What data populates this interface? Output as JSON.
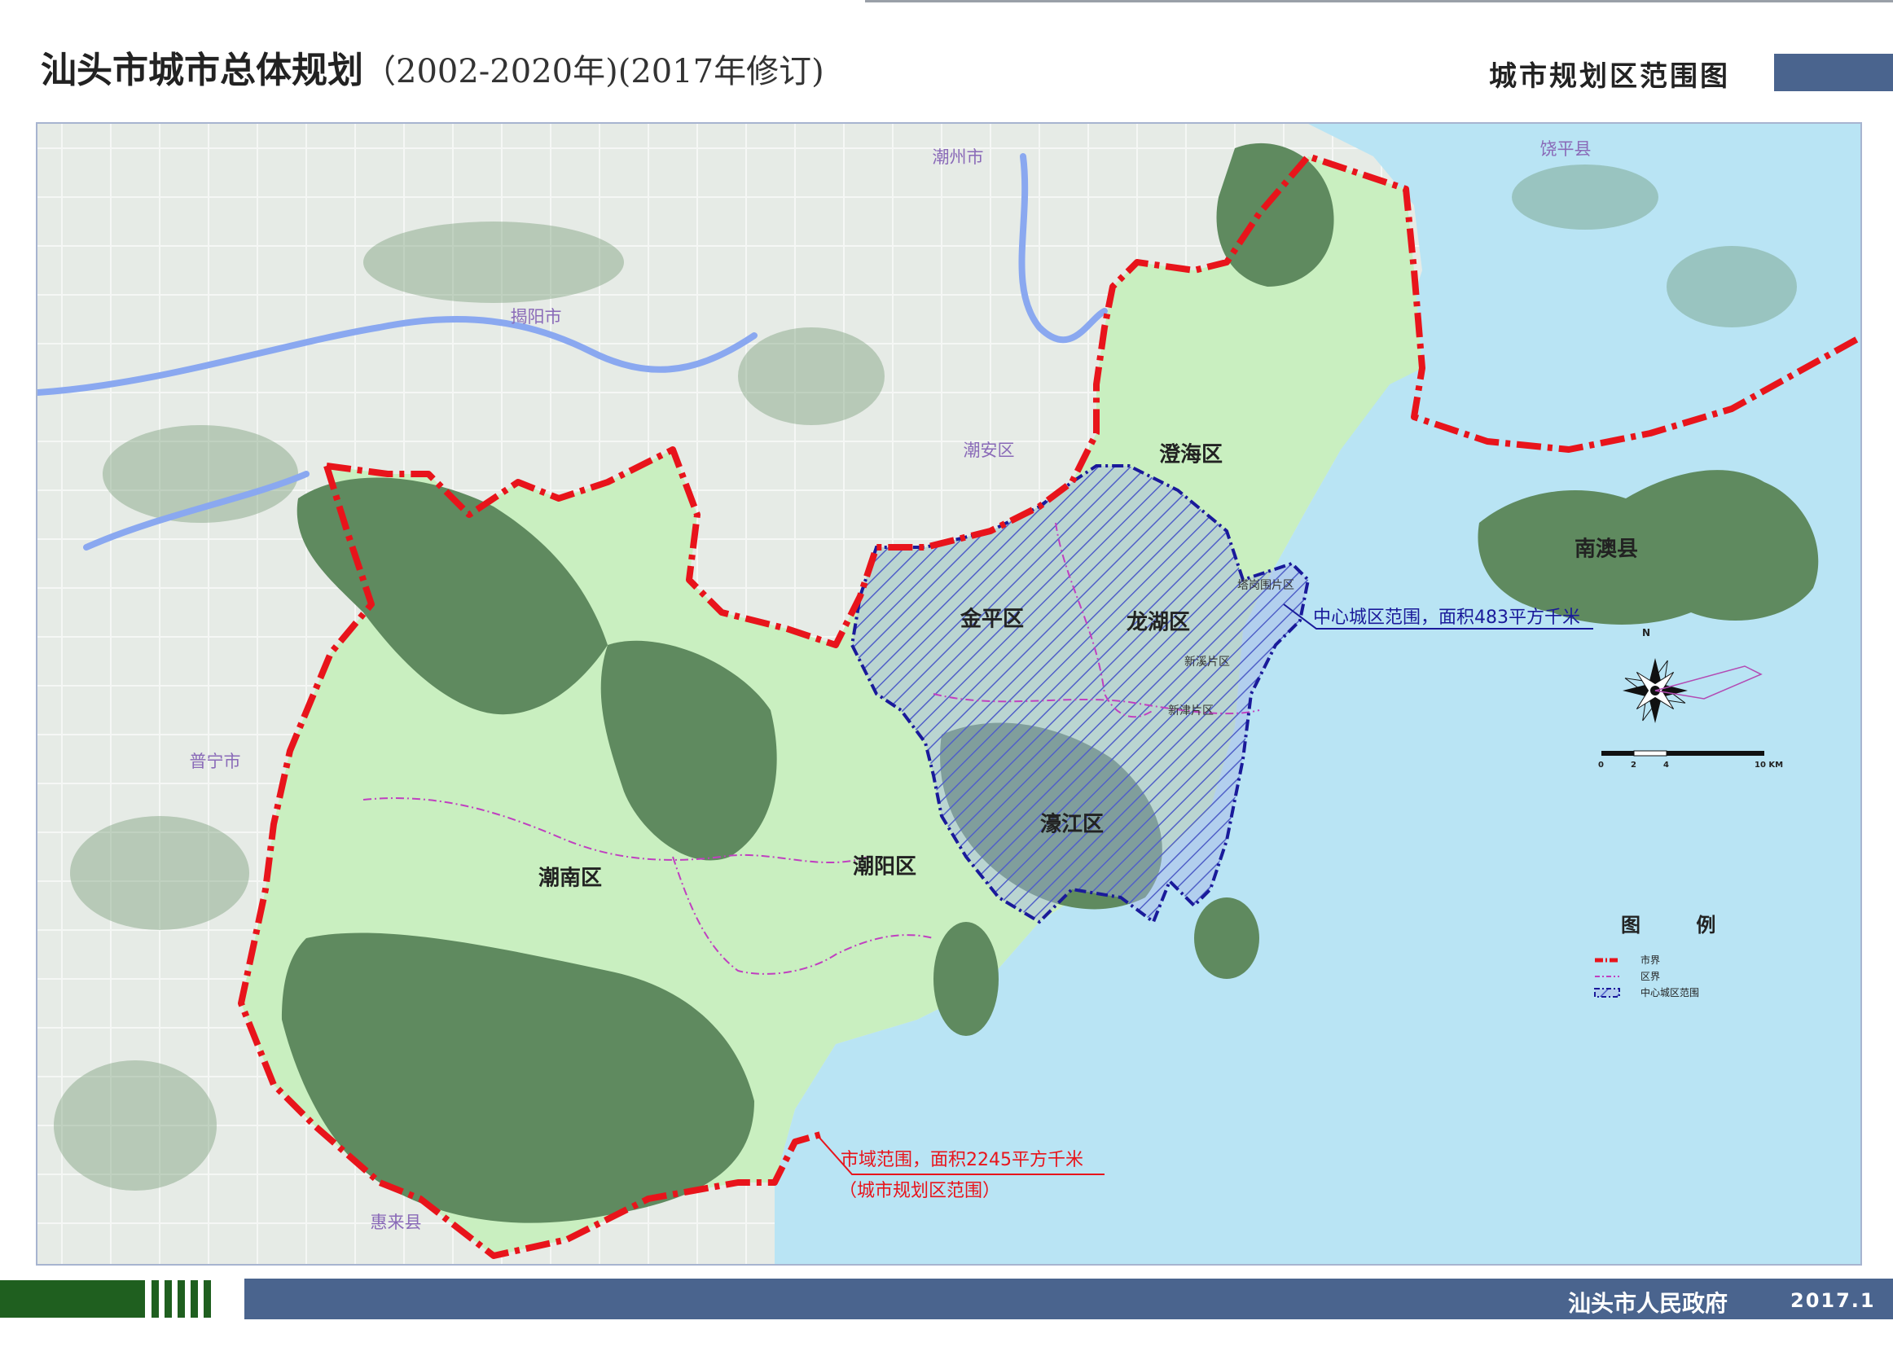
{
  "header": {
    "title": "汕头市城市总体规划",
    "subtitle": "（2002-2020年)(2017年修订)",
    "sheet_title": "城市规划区范围图"
  },
  "footer": {
    "issuer": "汕头市人民政府",
    "date": "2017.1"
  },
  "districts": {
    "chenghai": "澄海区",
    "jinping": "金平区",
    "longhu": "龙湖区",
    "haojiang": "濠江区",
    "chaoyang": "潮阳区",
    "chaonan": "潮南区",
    "nanao": "南澳县"
  },
  "neighbors": {
    "chaozhou": "潮州市",
    "raoping": "饶平县",
    "jieyang": "揭阳市",
    "chaoan": "潮安区",
    "puning": "普宁市",
    "huilai": "惠来县"
  },
  "subareas": {
    "tagang": "塔岗围片区",
    "xinxi": "新溪片区",
    "xinjin": "新津片区"
  },
  "callouts": {
    "center_city": "中心城区范围，面积483平方千米",
    "city_area": "市域范围，面积2245平方千米",
    "planning_area": "（城市规划区范围）"
  },
  "legend": {
    "title": "图  例",
    "items": [
      {
        "label": "市界",
        "style": "city-boundary"
      },
      {
        "label": "区界",
        "style": "district-boundary"
      },
      {
        "label": "中心城区范围",
        "style": "center-city-area"
      }
    ]
  },
  "scale_bar": {
    "ticks": [
      "0",
      "2",
      "4",
      "10 KM"
    ]
  },
  "north_arrow": {
    "label": "N"
  },
  "colors": {
    "header_block": "#4a648e",
    "footer_bar": "#4a648e",
    "footer_green": "#1f5f1f",
    "city_boundary": "#e8141b",
    "district_boundary": "#c040c0",
    "center_city_boundary": "#1a1a9a",
    "center_city_hatch": "#5060c8",
    "sea": "#b9e4f4",
    "forest": "#5f8a5f",
    "green_land": "#c9efc0",
    "outside_land": "#e6ebe6",
    "neighbor_label": "#8a6ab8",
    "callout_red": "#e8141b",
    "callout_blue": "#1a1a9a"
  },
  "icons": [
    "north-arrow-icon",
    "scale-bar-icon"
  ]
}
